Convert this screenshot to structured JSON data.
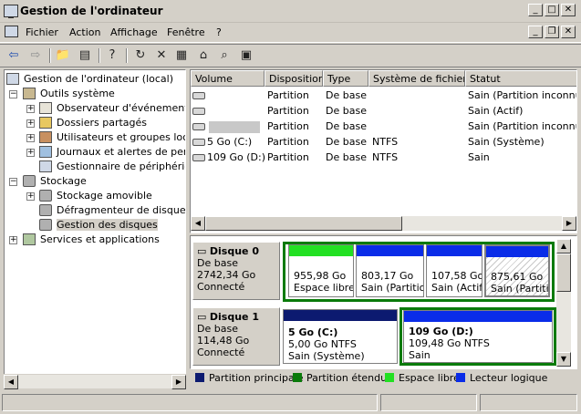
{
  "window": {
    "title": "Gestion de l'ordinateur"
  },
  "menu": {
    "items": [
      "Fichier",
      "Action",
      "Affichage",
      "Fenêtre",
      "?"
    ]
  },
  "tree": {
    "items": [
      {
        "label": "Gestion de l'ordinateur (local)",
        "icon": "computer-icon"
      },
      {
        "label": "Outils système",
        "icon": "tools-icon"
      },
      {
        "label": "Observateur d'événements",
        "icon": "event-viewer-icon"
      },
      {
        "label": "Dossiers partagés",
        "icon": "shared-folder-icon"
      },
      {
        "label": "Utilisateurs et groupes locaux",
        "icon": "users-icon"
      },
      {
        "label": "Journaux et alertes de performance",
        "icon": "performance-icon"
      },
      {
        "label": "Gestionnaire de périphériques",
        "icon": "device-manager-icon"
      },
      {
        "label": "Stockage",
        "icon": "storage-icon"
      },
      {
        "label": "Stockage amovible",
        "icon": "removable-storage-icon"
      },
      {
        "label": "Défragmenteur de disque",
        "icon": "defrag-icon"
      },
      {
        "label": "Gestion des disques",
        "icon": "disk-management-icon"
      },
      {
        "label": "Services et applications",
        "icon": "services-icon"
      }
    ]
  },
  "volumes": {
    "columns": [
      "Volume",
      "Disposition",
      "Type",
      "Système de fichiers",
      "Statut"
    ],
    "rows": [
      {
        "volume": "",
        "layout": "Partition",
        "type": "De base",
        "fs": "",
        "status": "Sain (Partition inconnue)"
      },
      {
        "volume": "",
        "layout": "Partition",
        "type": "De base",
        "fs": "",
        "status": "Sain (Actif)"
      },
      {
        "volume": "",
        "layout": "Partition",
        "type": "De base",
        "fs": "",
        "status": "Sain (Partition inconnue)"
      },
      {
        "volume": "5 Go (C:)",
        "layout": "Partition",
        "type": "De base",
        "fs": "NTFS",
        "status": "Sain (Système)"
      },
      {
        "volume": "109 Go (D:)",
        "layout": "Partition",
        "type": "De base",
        "fs": "NTFS",
        "status": "Sain"
      }
    ]
  },
  "disks": [
    {
      "name": "Disque 0",
      "kind": "De base",
      "size": "2742,34 Go",
      "state": "Connecté",
      "partitions": [
        {
          "title": "",
          "line1": "955,98 Go",
          "line2": "Espace libre",
          "color": "#22e022"
        },
        {
          "title": "",
          "line1": "803,17 Go",
          "line2": "Sain (Partitio",
          "color": "#0a2ce8"
        },
        {
          "title": "",
          "line1": "107,58 Go",
          "line2": "Sain (Actif",
          "color": "#0a2ce8"
        },
        {
          "title": "",
          "line1": "875,61 Go",
          "line2": "Sain (Partitio",
          "color": "#0a2ce8"
        }
      ]
    },
    {
      "name": "Disque 1",
      "kind": "De base",
      "size": "114,48 Go",
      "state": "Connecté",
      "partitions": [
        {
          "title": "5 Go  (C:)",
          "line1": "5,00 Go NTFS",
          "line2": "Sain (Système)",
          "color": "#0c1a70"
        },
        {
          "title": "109 Go  (D:)",
          "line1": "109,48 Go NTFS",
          "line2": "Sain",
          "color": "#0a2ce8"
        }
      ]
    }
  ],
  "legend": [
    {
      "label": "Partition principale",
      "color": "#0c1a70"
    },
    {
      "label": "Partition étendue",
      "color": "#0a7a0a"
    },
    {
      "label": "Espace libre",
      "color": "#22e022"
    },
    {
      "label": "Lecteur logique",
      "color": "#0a2ce8"
    }
  ]
}
